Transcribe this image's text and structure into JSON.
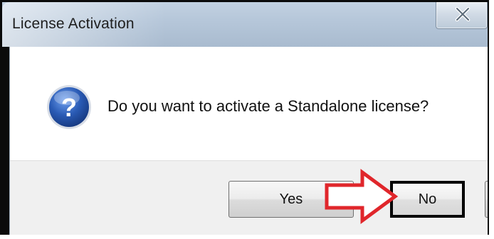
{
  "window": {
    "title": "License Activation",
    "close_icon": "close-icon"
  },
  "dialog": {
    "icon": "question-icon",
    "message": "Do you want to activate a Standalone license?"
  },
  "buttons": {
    "yes_label": "Yes",
    "no_label": "No"
  },
  "annotation": {
    "arrow_icon": "red-arrow-icon",
    "arrow_color": "#e0262b",
    "highlight_color": "#000000"
  },
  "colors": {
    "titlebar": "#b6c7da",
    "footer": "#f0f0f0",
    "icon_blue": "#2a5bb5"
  }
}
